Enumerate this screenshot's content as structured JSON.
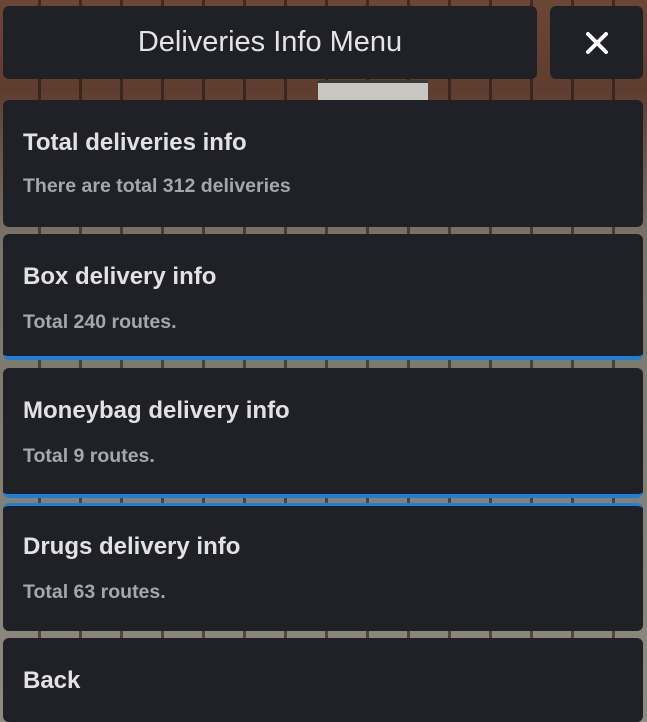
{
  "menu": {
    "title": "Deliveries Info Menu",
    "close_icon": "close-icon"
  },
  "items": [
    {
      "title": "Total deliveries info",
      "subtitle": "There are total 312 deliveries"
    },
    {
      "title": "Box delivery info",
      "subtitle": "Total 240 routes."
    },
    {
      "title": "Moneybag delivery info",
      "subtitle": "Total 9 routes."
    },
    {
      "title": "Drugs delivery info",
      "subtitle": "Total 63 routes."
    },
    {
      "title": "Back"
    }
  ],
  "colors": {
    "panel": "#202126",
    "accent": "#1e7fd6",
    "title_text": "#e2e2e4",
    "subtitle_text": "#a6a7ac"
  }
}
